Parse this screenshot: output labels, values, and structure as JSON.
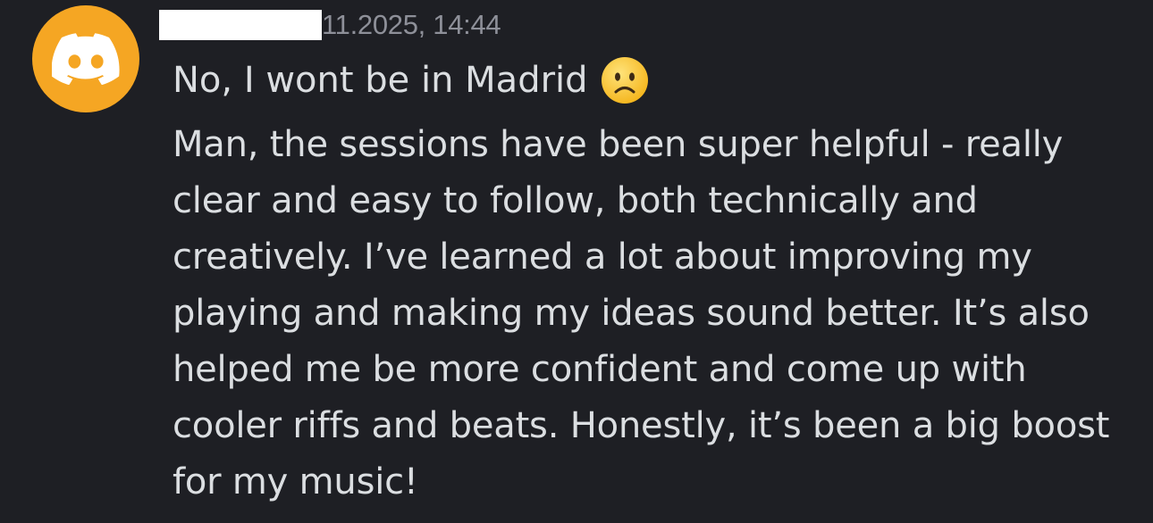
{
  "message": {
    "timestamp": "11.2025, 14:44",
    "first_line": "No, I wont be in Madrid",
    "emoji": "slightly-frowning-face",
    "body_lines": [
      "Man, the sessions have been super helpful - really",
      "clear and easy to follow, both technically and",
      "creatively. I’ve learned a lot about improving my",
      "playing and making my ideas sound better. It’s also",
      "helped me be more confident and come up with",
      "cooler riffs and beats. Honestly, it’s been a big boost",
      "for my music!"
    ]
  },
  "colors": {
    "background": "#1e1f24",
    "avatar": "#f5a623",
    "text": "#dbdee1",
    "timestamp": "#8e9099"
  }
}
